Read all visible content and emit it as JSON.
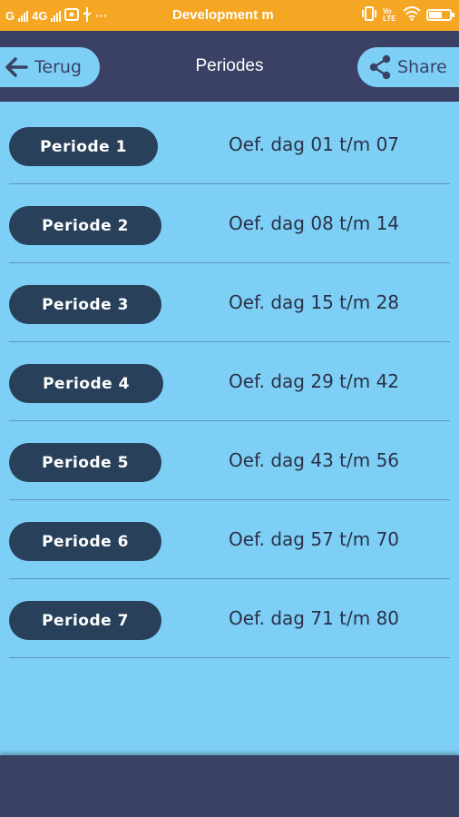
{
  "status_bar": {
    "left_text": "G",
    "network": "4G",
    "more": "···",
    "app_title": "Development m",
    "volte": "Vo LTE",
    "background": "#F5A623"
  },
  "header": {
    "title": "Periodes",
    "back_label": "Terug",
    "share_label": "Share",
    "background": "#3A4164",
    "button_color": "#7ECFF5"
  },
  "periods": [
    {
      "label": "Periode 1",
      "range": "Oef. dag 01 t/m 07"
    },
    {
      "label": "Periode 2",
      "range": "Oef. dag 08 t/m 14"
    },
    {
      "label": "Periode 3",
      "range": "Oef. dag 15 t/m 28"
    },
    {
      "label": "Periode 4",
      "range": "Oef. dag 29 t/m 42"
    },
    {
      "label": "Periode 5",
      "range": "Oef. dag 43 t/m 56"
    },
    {
      "label": "Periode 6",
      "range": "Oef. dag 57 t/m 70"
    },
    {
      "label": "Periode 7",
      "range": "Oef. dag 71 t/m 80"
    }
  ],
  "colors": {
    "page_background": "#7ECFF5",
    "period_button": "#28405A",
    "bottom_bar": "#3A4164"
  }
}
